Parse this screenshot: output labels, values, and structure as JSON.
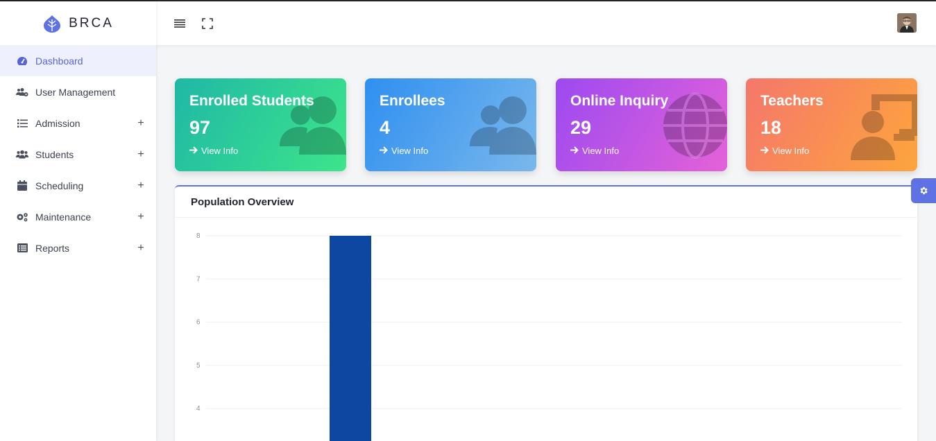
{
  "brand": {
    "name": "BRCA"
  },
  "sidebar": {
    "items": [
      {
        "label": "Dashboard",
        "icon": "tachometer-icon",
        "active": true,
        "expandable": false
      },
      {
        "label": "User Management",
        "icon": "users-cog-icon",
        "active": false,
        "expandable": false
      },
      {
        "label": "Admission",
        "icon": "list-icon",
        "active": false,
        "expandable": true
      },
      {
        "label": "Students",
        "icon": "users-icon",
        "active": false,
        "expandable": true
      },
      {
        "label": "Scheduling",
        "icon": "calendar-icon",
        "active": false,
        "expandable": true
      },
      {
        "label": "Maintenance",
        "icon": "cogs-icon",
        "active": false,
        "expandable": true
      },
      {
        "label": "Reports",
        "icon": "report-icon",
        "active": false,
        "expandable": true
      }
    ],
    "expand_symbol": "+"
  },
  "cards": [
    {
      "title": "Enrolled Students",
      "value": "97",
      "link": "View Info",
      "icon": "users-icon"
    },
    {
      "title": "Enrollees",
      "value": "4",
      "link": "View Info",
      "icon": "users-icon"
    },
    {
      "title": "Online Inquiry",
      "value": "29",
      "link": "View Info",
      "icon": "globe-icon"
    },
    {
      "title": "Teachers",
      "value": "18",
      "link": "View Info",
      "icon": "teacher-icon"
    }
  ],
  "panel": {
    "title": "Population Overview"
  },
  "colors": {
    "accent": "#5e72e4",
    "bar": "#0d47a1"
  },
  "chart_data": {
    "type": "bar",
    "title": "",
    "categories": [
      ""
    ],
    "series": [
      {
        "values": [
          8
        ]
      }
    ],
    "y_ticks": [
      "8",
      "7",
      "6",
      "5",
      "4"
    ],
    "ylim_visible": [
      4,
      8
    ],
    "grid": true
  }
}
